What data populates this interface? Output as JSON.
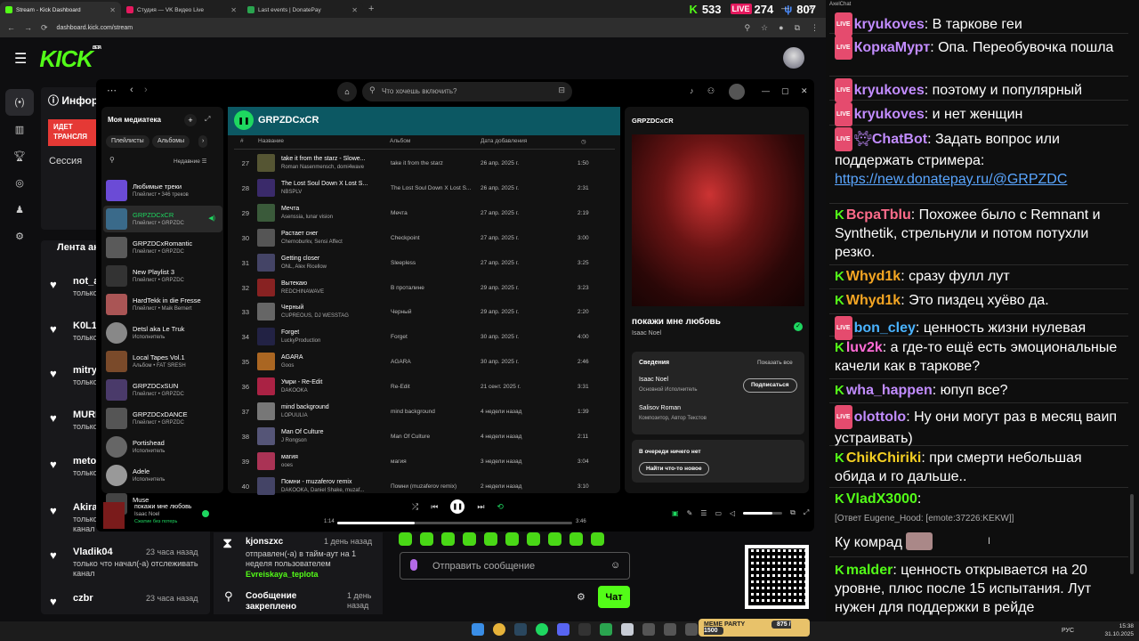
{
  "browser": {
    "tabs": [
      {
        "label": "Stream - Kick Dashboard",
        "color": "#53fc18"
      },
      {
        "label": "Студия — VK Видео Live",
        "color": "#e5195e"
      },
      {
        "label": "Last events | DonatePay",
        "color": "#2aa44f"
      }
    ],
    "url": "dashboard.kick.com/stream"
  },
  "counters": [
    {
      "icon": "K",
      "value": "533",
      "color": "#53fc18"
    },
    {
      "icon": "LIVE",
      "value": "274",
      "color": "#e5195e"
    },
    {
      "icon": "ψ",
      "value": "807",
      "color": "#4a8cff"
    }
  ],
  "kick": {
    "logo": "KICK",
    "beta": "BETA",
    "info_title": "Инфор",
    "live_label": "ИДЕТ ТРАНСЛЯ",
    "session_label": "Сессия",
    "feed_title": "Лента активно",
    "feed": [
      {
        "name": "not_a",
        "time": "",
        "desc": "только отслежива"
      },
      {
        "name": "K0L10",
        "time": "",
        "desc": "только отслежива"
      },
      {
        "name": "mitry",
        "time": "",
        "desc": "только отслежива"
      },
      {
        "name": "MURI",
        "time": "",
        "desc": "только отслежива"
      },
      {
        "name": "meto",
        "time": "",
        "desc": "только отслежива"
      },
      {
        "name": "Akira",
        "time": "",
        "desc": "только что начал(-а) отслеживать канал"
      },
      {
        "name": "Vladik04",
        "time": "23 часа назад",
        "desc": "только что начал(-а) отслеживать канал"
      },
      {
        "name": "czbr",
        "time": "23 часа назад",
        "desc": ""
      }
    ],
    "bottom": {
      "user": "kjonszxc",
      "time": "1 день назад",
      "desc": "отправлен(-а) в тайм-аут на 1 неделя пользователем",
      "by": "Evreiskaya_teplota",
      "pinned": "Сообщение закреплено",
      "pinned_time": "1 день назад"
    },
    "chat_placeholder": "Отправить сообщение",
    "chat_button": "Чат"
  },
  "spotify": {
    "search_placeholder": "Что хочешь включить?",
    "library_title": "Моя медиатека",
    "chips": [
      "Плейлисты",
      "Альбомы"
    ],
    "sort": "Недавние",
    "library": [
      {
        "name": "Любимые треки",
        "sub": "Плейлист • 346 треков",
        "color": "#6b4bd6"
      },
      {
        "name": "GRPZDCxCR",
        "sub": "Плейлист • GRPZDC",
        "color": "#3a6a8a",
        "selected": true
      },
      {
        "name": "GRPZDCxRomantic",
        "sub": "Плейлист • GRPZDC",
        "color": "#5a5a5a"
      },
      {
        "name": "New Playlist 3",
        "sub": "Плейлист • GRPZDC",
        "color": "#333"
      },
      {
        "name": "HardTekk in die Fresse",
        "sub": "Плейлист • Maik Bernert",
        "color": "#a55"
      },
      {
        "name": "Detsl aka Le Truk",
        "sub": "Исполнитель",
        "color": "#888"
      },
      {
        "name": "Local Tapes Vol.1",
        "sub": "Альбом • FAT SRESH",
        "color": "#7a4a2a"
      },
      {
        "name": "GRPZDCxSUN",
        "sub": "Плейлист • GRPZDC",
        "color": "#4a3a6a"
      },
      {
        "name": "GRPZDCxDANCE",
        "sub": "Плейлист • GRPZDC",
        "color": "#555"
      },
      {
        "name": "Portishead",
        "sub": "Исполнитель",
        "color": "#666"
      },
      {
        "name": "Adele",
        "sub": "Исполнитель",
        "color": "#999"
      },
      {
        "name": "Muse",
        "sub": "",
        "color": "#444"
      }
    ],
    "playlist": "GRPZDCxCR",
    "columns": {
      "num": "#",
      "title": "Название",
      "album": "Альбом",
      "date": "Дата добавления"
    },
    "tracks": [
      {
        "n": "27",
        "title": "take it from the starz - Slowe...",
        "artist": "Roman Nasenmensch, domi4wave",
        "album": "take it from the starz",
        "date": "26 апр. 2025 г.",
        "dur": "1:50",
        "color": "#553"
      },
      {
        "n": "28",
        "title": "The Lost Soul Down X Lost S...",
        "artist": "NBSPLV",
        "album": "The Lost Soul Down X Lost S...",
        "date": "26 апр. 2025 г.",
        "dur": "2:31",
        "color": "#3a2a6a"
      },
      {
        "n": "29",
        "title": "Мечта",
        "artist": "Asenssia, lunar vision",
        "album": "Мечта",
        "date": "27 апр. 2025 г.",
        "dur": "2:19",
        "color": "#3a5a3a"
      },
      {
        "n": "30",
        "title": "Растает снег",
        "artist": "Chernoburkv, Sensi Affect",
        "album": "Checkpoint",
        "date": "27 апр. 2025 г.",
        "dur": "3:00",
        "color": "#555"
      },
      {
        "n": "31",
        "title": "Getting closer",
        "artist": "ONL, Alex Ricellow",
        "album": "Sleepless",
        "date": "27 апр. 2025 г.",
        "dur": "3:25",
        "color": "#446"
      },
      {
        "n": "32",
        "title": "Вытекаю",
        "artist": "REDCHINAWAVE",
        "album": "В проталине",
        "date": "29 апр. 2025 г.",
        "dur": "3:23",
        "color": "#822"
      },
      {
        "n": "33",
        "title": "Черный",
        "artist": "CUPREOUS, DJ WESSTAG",
        "album": "Черный",
        "date": "29 апр. 2025 г.",
        "dur": "2:20",
        "color": "#666"
      },
      {
        "n": "34",
        "title": "Forget",
        "artist": "LuckyProduction",
        "album": "Forget",
        "date": "30 апр. 2025 г.",
        "dur": "4:00",
        "color": "#224"
      },
      {
        "n": "35",
        "title": "AGARA",
        "artist": "Goos",
        "album": "AGARA",
        "date": "30 апр. 2025 г.",
        "dur": "2:46",
        "color": "#a62"
      },
      {
        "n": "36",
        "title": "Умри - Re-Edit",
        "artist": "DAKOOKA",
        "album": "Re-Edit",
        "date": "21 сент. 2025 г.",
        "dur": "3:31",
        "color": "#a24"
      },
      {
        "n": "37",
        "title": "mind background",
        "artist": "LOPUULIA",
        "album": "mind background",
        "date": "4 недели назад",
        "dur": "1:39",
        "color": "#777"
      },
      {
        "n": "38",
        "title": "Man Of Culture",
        "artist": "J Rongson",
        "album": "Man Of Culture",
        "date": "4 недели назад",
        "dur": "2:11",
        "color": "#557"
      },
      {
        "n": "39",
        "title": "магия",
        "artist": "ooes",
        "album": "магия",
        "date": "3 недели назад",
        "dur": "3:04",
        "color": "#a35"
      },
      {
        "n": "40",
        "title": "Помни - muzaferov remix",
        "artist": "DAKOOKA, Daniel Shake, muzaf...",
        "album": "Помни (muzaferov remix)",
        "date": "2 недели назад",
        "dur": "3:10",
        "color": "#446"
      }
    ],
    "now_playing": {
      "playlist": "GRPZDCxCR",
      "song": "покажи мне любовь",
      "artist": "Isaac Noel",
      "credits_title": "Сведения",
      "show_all": "Показать все",
      "credit1_name": "Isaac Noel",
      "credit1_role": "Основной Исполнитель",
      "follow": "Подписаться",
      "credit2_name": "Salisov Roman",
      "credit2_role": "Композитор, Автор Текстов",
      "queue_title": "В очереди ничего нет",
      "find_new": "Найти что-то новое"
    },
    "player": {
      "song": "покажи мне любовь",
      "artist": "Isaac Noel",
      "saved": "Сжатие без потерь",
      "cur": "1:14",
      "total": "3:46",
      "progress": 0.33,
      "volume": 0.75
    }
  },
  "chat": {
    "title": "AxelChat",
    "messages": [
      {
        "badge": "live",
        "user": "kryukoves",
        "color": "#c28cff",
        "text": "В таркове геи"
      },
      {
        "badge": "live",
        "user": "КоркаМурт",
        "color": "#c28cff",
        "text": "Опа. Переобувочка пошла"
      },
      {
        "badge": "live",
        "user": "kryukoves",
        "color": "#c28cff",
        "text": "поэтому и популярный"
      },
      {
        "badge": "live",
        "user": "kryukoves",
        "color": "#c28cff",
        "text": "и нет женщин"
      },
      {
        "badge": "live",
        "user": "ChatBot",
        "color": "#c28cff",
        "text": "Задать вопрос или поддержать стримера:",
        "link": "https://new.donatepay.ru/@GRPZDC"
      },
      {
        "badge": "kick",
        "user": "BcpaTblu",
        "color": "#ff6b8a",
        "text": "Похожее было с Remnant и Synthetik, стрельнули и потом потухли резко."
      },
      {
        "badge": "kick",
        "user": "Whyd1k",
        "color": "#f5a623",
        "text": "сразу фулл лут"
      },
      {
        "badge": "kick",
        "user": "Whyd1k",
        "color": "#f5a623",
        "text": "Это пиздец хуёво да."
      },
      {
        "badge": "live",
        "user": "bon_cley",
        "color": "#4ab3ff",
        "text": "ценность жизни нулевая"
      },
      {
        "badge": "kick",
        "user": "luv2k",
        "color": "#ff6bd5",
        "text": "а где-то ещё есть эмоциональные качели как в таркове?"
      },
      {
        "badge": "kick",
        "user": "wha_happen",
        "color": "#c28cff",
        "text": "юпуп все?"
      },
      {
        "badge": "live",
        "user": "olottolo",
        "color": "#c28cff",
        "text": "Ну они могут раз в месяц ваип устраивать)"
      },
      {
        "badge": "kick",
        "user": "ChikChiriki",
        "color": "#f5d023",
        "text": "при смерти небольшая обида и го дальше.."
      },
      {
        "badge": "kick",
        "user": "VladX3000",
        "color": "#53fc18",
        "text": ""
      },
      {
        "badge": "kick",
        "user": "malder",
        "color": "#53fc18",
        "text": "ценность открывается на 20 уровне, плюс после 15 испытания. Лут нужен для поддержки в рейде"
      }
    ],
    "reply": "[Ответ Eugene_Hood: [emote:37226:KEKW]]",
    "reply_text": "Ку комрад"
  },
  "taskbar": {
    "lang": "РУС",
    "time": "15:38",
    "date": "31.10.2025",
    "meme": "MEME PARTY",
    "meme_score": "875 / 1500"
  }
}
